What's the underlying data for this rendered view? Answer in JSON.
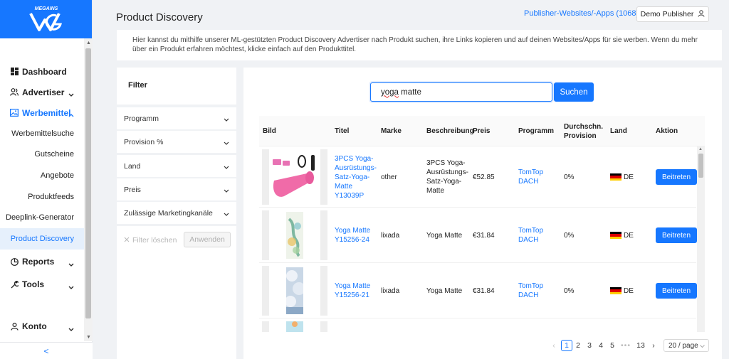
{
  "brand": {
    "logo_text": "MEGAINS",
    "accent": "#1677ff"
  },
  "sidebar": {
    "items": [
      {
        "label": "Dashboard",
        "icon": "dashboard-icon"
      },
      {
        "label": "Advertiser",
        "icon": "users-icon"
      },
      {
        "label": "Werbemittel",
        "icon": "image-icon"
      },
      {
        "label": "Reports",
        "icon": "pie-chart-icon"
      },
      {
        "label": "Tools",
        "icon": "wrench-icon"
      },
      {
        "label": "Konto",
        "icon": "user-icon"
      }
    ],
    "subitems": [
      "Werbemittelsuche",
      "Gutscheine",
      "Angebote",
      "Produktfeeds",
      "Deeplink-Generator",
      "Product Discovery"
    ],
    "collapse": "<"
  },
  "header": {
    "title": "Product Discovery",
    "websites": "Publisher-Websites/-Apps (1068)",
    "publisher": "Demo Publisher"
  },
  "info": "Hier kannst du mithilfe unserer ML-gestützten Product Discovery Advertiser nach Produkt suchen, ihre Links kopieren und auf deinen Websites/Apps für sie werben. Wenn du mehr über ein Produkt erfahren möchtest, klicke einfach auf den Produkttitel.",
  "filter": {
    "title": "Filter",
    "items": [
      "Programm",
      "Provision %",
      "Land",
      "Preis",
      "Zulässige Marketingkanäle"
    ],
    "clear": "Filter löschen",
    "apply": "Anwenden"
  },
  "search": {
    "word1": "yoga",
    "word2": " matte",
    "button": "Suchen"
  },
  "table": {
    "headers": {
      "bild": "Bild",
      "titel": "Titel",
      "marke": "Marke",
      "beschreibung": "Beschreibung",
      "preis": "Preis",
      "programm": "Programm",
      "provision": "Durchschn. Provision",
      "land": "Land",
      "aktion": "Aktion"
    },
    "rows": [
      {
        "title": "3PCS Yoga-Ausrüstungs-Satz-Yoga-Matte Y13039P",
        "brand": "other",
        "description": "3PCS Yoga-Ausrüstungs-Satz-Yoga-Matte",
        "price": "€52.85",
        "program": "TomTop DACH",
        "commission": "0%",
        "country": "DE",
        "action": "Beitreten"
      },
      {
        "title": "Yoga Matte Y15256-24",
        "brand": "lixada",
        "description": "Yoga Matte",
        "price": "€31.84",
        "program": "TomTop DACH",
        "commission": "0%",
        "country": "DE",
        "action": "Beitreten"
      },
      {
        "title": "Yoga Matte Y15256-21",
        "brand": "lixada",
        "description": "Yoga Matte",
        "price": "€31.84",
        "program": "TomTop DACH",
        "commission": "0%",
        "country": "DE",
        "action": "Beitreten"
      }
    ]
  },
  "pagination": {
    "prev": "‹",
    "pages": [
      "1",
      "2",
      "3",
      "4",
      "5"
    ],
    "ellipsis": "•••",
    "last": "13",
    "next": "›",
    "page_size": "20 / page",
    "current": "1"
  }
}
